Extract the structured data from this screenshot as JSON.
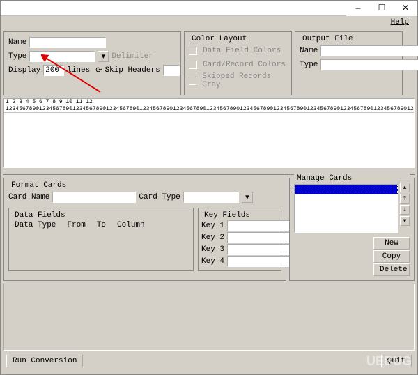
{
  "menubar": {
    "help": "Help"
  },
  "source": {
    "name_label": "Name",
    "name_value": "",
    "type_label": "Type",
    "type_value": "",
    "display_label": "Display",
    "display_value": "200",
    "lines_label": "lines",
    "delimiter_label": "Delimiter",
    "skip_headers_label": "Skip Headers",
    "skip_value": ""
  },
  "color_layout": {
    "legend": "Color Layout",
    "data_field": "Data Field Colors",
    "card_record": "Card/Record Colors",
    "skipped_grey": "Skipped Records Grey"
  },
  "output": {
    "legend": "Output File",
    "name_label": "Name",
    "name_value": "",
    "type_label": "Type",
    "type_value": ""
  },
  "ruler": {
    "top": "      1         2         3         4         5         6         7         8         9        10        11        12",
    "bottom": "123456789012345678901234567890123456789012345678901234567890123456789012345678901234567890123456789012345678901234567890123456"
  },
  "format": {
    "legend": "Format Cards",
    "card_name_label": "Card Name",
    "card_name_value": "",
    "card_type_label": "Card Type",
    "card_type_value": "",
    "data_fields": {
      "legend": "Data Fields",
      "data_type": "Data Type",
      "from": "From",
      "to": "To",
      "column": "Column"
    },
    "key_fields": {
      "legend": "Key Fields",
      "key1": "Key 1",
      "key2": "Key 2",
      "key3": "Key 3",
      "key4": "Key 4",
      "v1": "",
      "v2": "",
      "v3": "",
      "v4": ""
    }
  },
  "manage": {
    "legend": "Manage Cards",
    "new": "New",
    "copy": "Copy",
    "delete": "Delete"
  },
  "footer": {
    "run": "Run Conversion",
    "quit": "Quit"
  },
  "watermark": "UEBUG"
}
